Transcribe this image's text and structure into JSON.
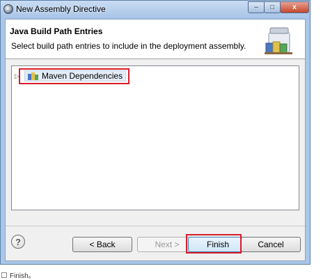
{
  "window": {
    "title": "New Assembly Directive",
    "controls": {
      "minimize": "–",
      "maximize": "□",
      "close": "x"
    }
  },
  "banner": {
    "title": "Java Build Path Entries",
    "description": "Select build path entries to include in the deployment assembly."
  },
  "tree": {
    "items": [
      {
        "label": "Maven Dependencies",
        "expanded": false
      }
    ]
  },
  "buttons": {
    "help": "?",
    "back": "< Back",
    "next": "Next >",
    "finish": "Finish",
    "cancel": "Cancel"
  },
  "caption": "Finish。",
  "colors": {
    "highlight": "#d81b2a",
    "titlebar": "#a6c3e6",
    "tree_selection": "#e3ecf7"
  }
}
